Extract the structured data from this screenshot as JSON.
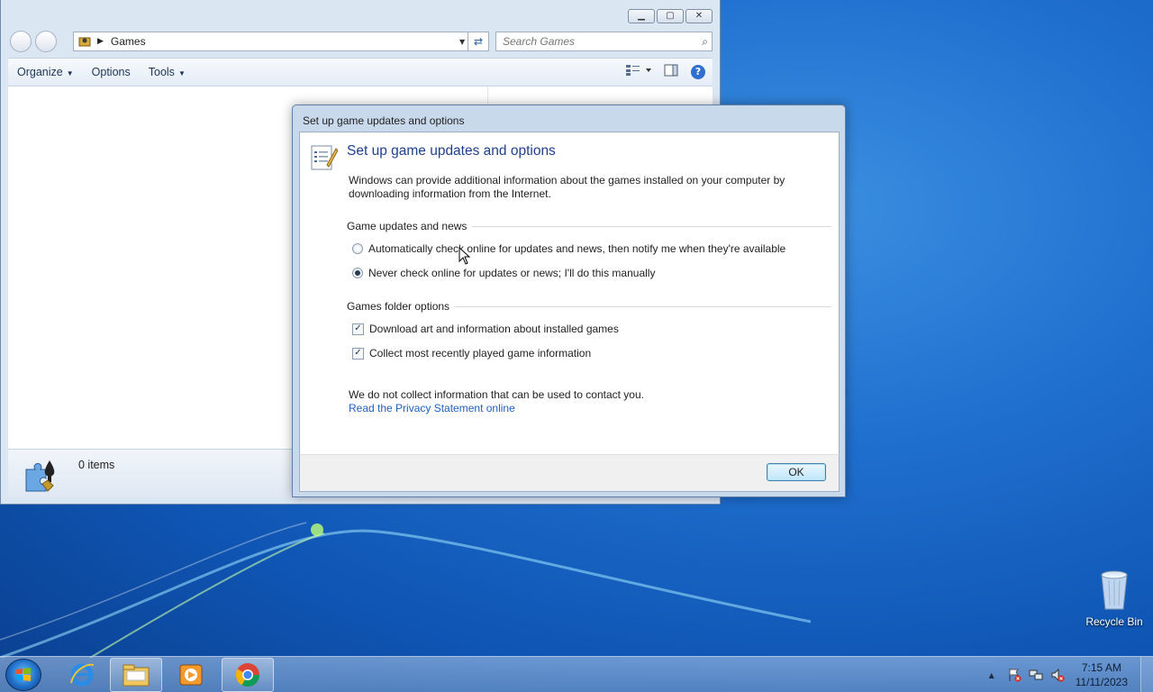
{
  "explorer": {
    "address": "Games",
    "search_placeholder": "Search Games",
    "toolbar": {
      "organize": "Organize",
      "options": "Options",
      "tools": "Tools"
    },
    "status_count": "0 items"
  },
  "dialog": {
    "title": "Set up game updates and options",
    "heading": "Set up game updates and options",
    "intro": "Windows can provide additional information about the games installed on your computer by downloading information from the Internet.",
    "group1_title": "Game updates and news",
    "radio_auto": "Automatically check online for updates and news, then notify me when they're available",
    "radio_never": "Never check online for updates or news; I'll do this manually",
    "radio_selected": "never",
    "group2_title": "Games folder options",
    "check_download_art": "Download art and information about installed games",
    "check_download_art_checked": true,
    "check_recent": "Collect most recently played game information",
    "check_recent_checked": true,
    "privacy_text": "We do not collect information that can be used to contact you.",
    "privacy_link": "Read the Privacy Statement online",
    "ok_label": "OK"
  },
  "desktop": {
    "recycle_bin_label": "Recycle Bin"
  },
  "taskbar": {
    "apps": [
      "internet-explorer-icon",
      "windows-explorer-icon",
      "media-player-icon",
      "chrome-icon"
    ],
    "clock_time": "7:15 AM",
    "clock_date": "11/11/2023"
  },
  "colors": {
    "heading_blue": "#1f3f8c",
    "link_blue": "#1f5fbf",
    "desktop_blue": "#1f6fcf"
  }
}
